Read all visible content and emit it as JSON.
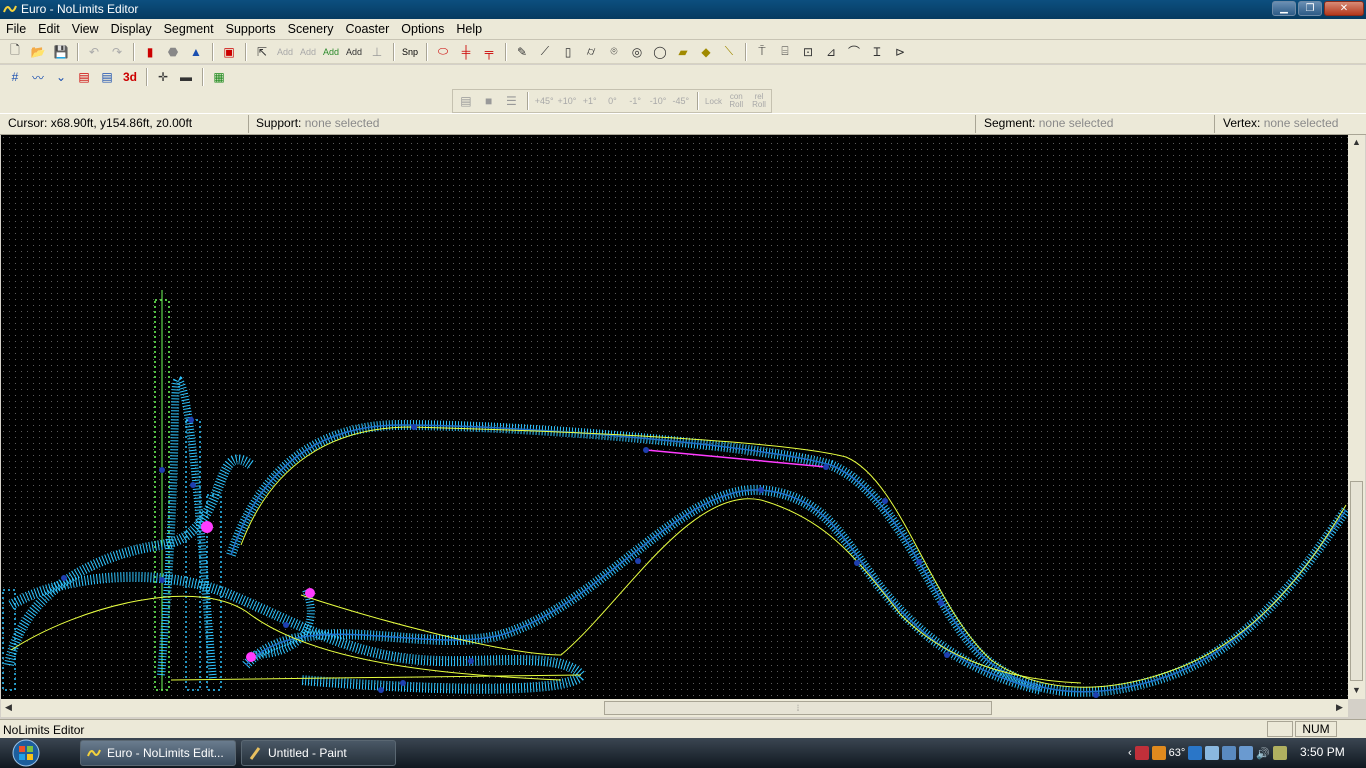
{
  "window": {
    "title": "Euro - NoLimits Editor"
  },
  "menu": [
    "File",
    "Edit",
    "View",
    "Display",
    "Segment",
    "Supports",
    "Scenery",
    "Coaster",
    "Options",
    "Help"
  ],
  "toolbar": {
    "snap_label": "Snp",
    "add_labels": [
      "Add",
      "Add",
      "Add",
      "Add"
    ],
    "view3d_label": "3d",
    "angle_buttons": [
      "+45°",
      "+10°",
      "+1°",
      "0°",
      "-1°",
      "-10°",
      "-45°"
    ],
    "roll_buttons": [
      "Lock",
      "con Roll",
      "rel Roll"
    ]
  },
  "info": {
    "cursor_label": "Cursor:",
    "cursor_value": "x68.90ft, y154.86ft, z0.00ft",
    "support_label": "Support:",
    "support_value": "none selected",
    "segment_label": "Segment:",
    "segment_value": "none selected",
    "vertex_label": "Vertex:",
    "vertex_value": "none selected"
  },
  "status": {
    "text": "NoLimits Editor",
    "num": "NUM"
  },
  "taskbar": {
    "tasks": [
      "Euro - NoLimits Edit...",
      "Untitled - Paint"
    ],
    "tray_temp": "63°",
    "clock": "3:50 PM"
  },
  "colors": {
    "track": "#2ec4ff",
    "spine": "#1e6ec8",
    "heartline": "#e8ff40",
    "support": "#6fff5a",
    "selection": "#ff3cff"
  }
}
